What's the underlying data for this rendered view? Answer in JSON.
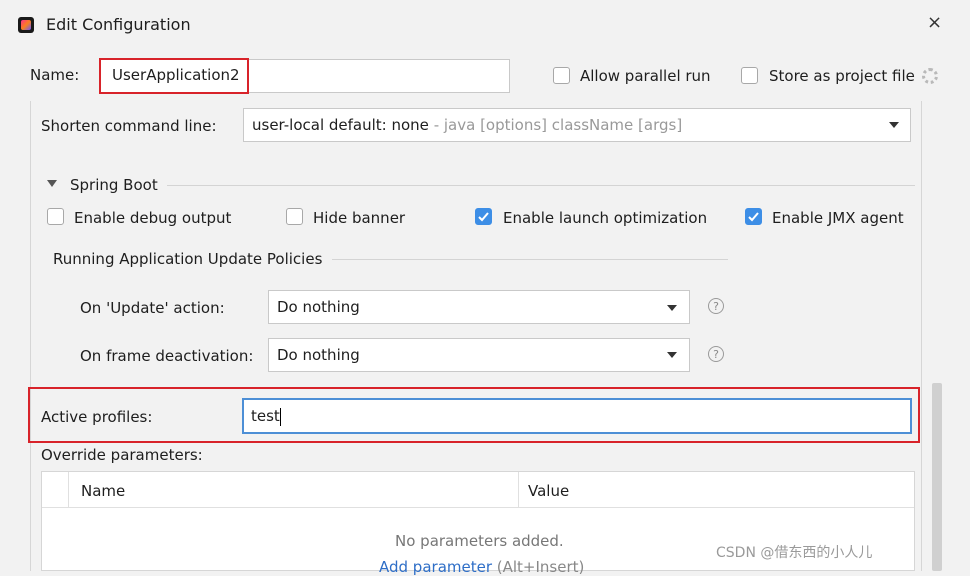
{
  "title": "Edit Configuration",
  "name_label": "Name:",
  "name_value": "UserApplication2",
  "allow_parallel_label": "Allow parallel run",
  "store_project_label": "Store as project file",
  "shorten_label": "Shorten command line:",
  "shorten_value": "user-local default: none",
  "shorten_hint": " - java [options] className [args]",
  "spring_boot_label": "Spring Boot",
  "checkboxes": [
    {
      "label": "Enable debug output",
      "checked": false
    },
    {
      "label": "Hide banner",
      "checked": false
    },
    {
      "label": "Enable launch optimization",
      "checked": true
    },
    {
      "label": "Enable JMX agent",
      "checked": true
    }
  ],
  "policies_label": "Running Application Update Policies",
  "update_action_label": "On 'Update' action:",
  "update_action_value": "Do nothing",
  "frame_deactivation_label": "On frame deactivation:",
  "frame_deactivation_value": "Do nothing",
  "active_profiles_label": "Active profiles:",
  "active_profiles_value": "test",
  "override_label": "Override parameters:",
  "table_headers": [
    "Name",
    "Value"
  ],
  "empty_text": "No parameters added.",
  "add_link": "Add parameter",
  "add_shortcut": " (Alt+Insert)",
  "watermark": "CSDN @借东西的小人儿",
  "help_glyph": "?",
  "close_glyph": "×",
  "colors": {
    "accent": "#3d8ee6",
    "highlight": "#d8232a",
    "link": "#2e6ec7"
  }
}
